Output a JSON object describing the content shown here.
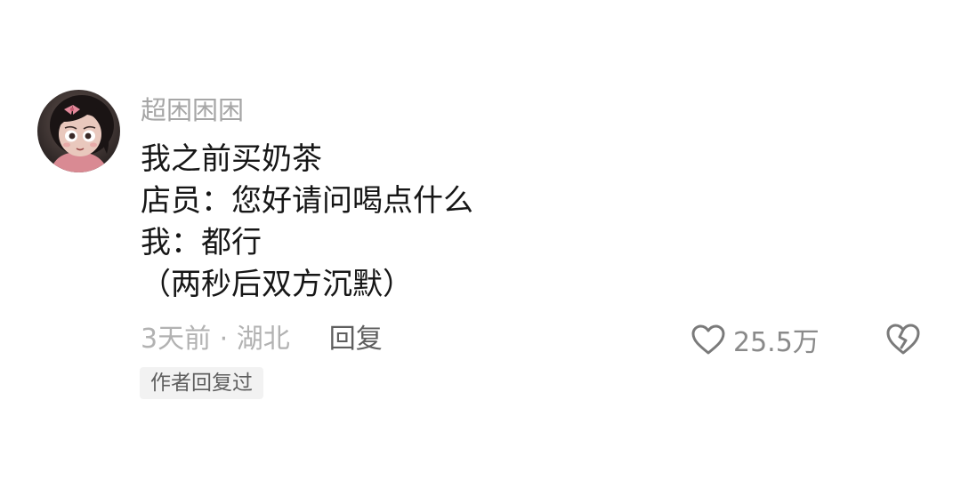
{
  "comment": {
    "username": "超困困困",
    "avatar_icon": "cartoon-girl-avatar",
    "lines": [
      "我之前买奶茶",
      "店员：您好请问喝点什么",
      "我：都行",
      "（两秒后双方沉默）"
    ],
    "time_location": "3天前 · 湖北",
    "reply_label": "回复",
    "like_icon": "heart-outline-icon",
    "like_count": "25.5万",
    "dislike_icon": "broken-heart-icon",
    "author_badge": "作者回复过"
  }
}
